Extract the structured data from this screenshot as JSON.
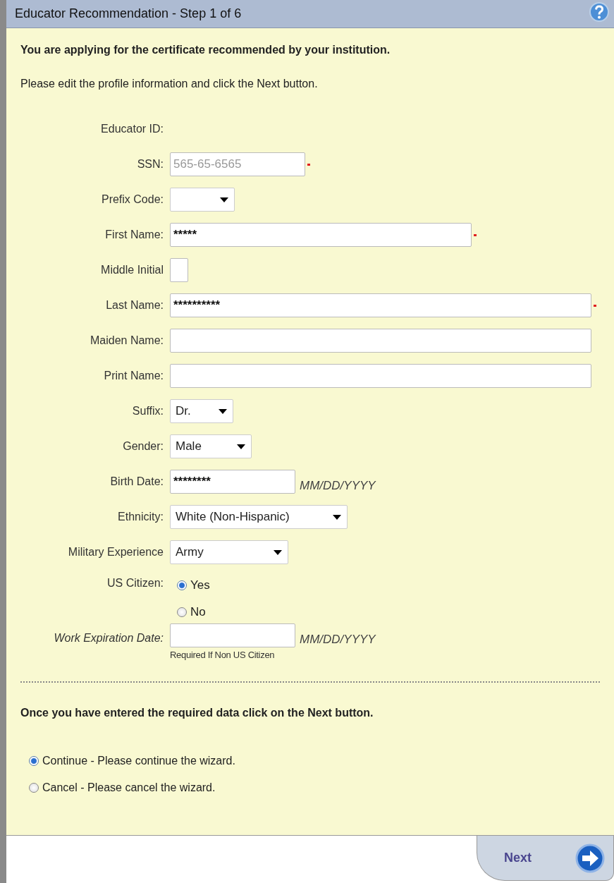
{
  "window": {
    "title": "Educator Recommendation - Step 1 of 6"
  },
  "intro": [
    "You are applying for the certificate recommended by your institution.",
    "Please edit the profile information and click the Next button."
  ],
  "fields": [
    {
      "kind": "label",
      "label": "Educator ID:"
    },
    {
      "kind": "text",
      "label": "SSN:",
      "placeholder": "565-65-6565",
      "required": true
    },
    {
      "kind": "select",
      "label": "Prefix Code:"
    },
    {
      "kind": "text",
      "label": "First Name:",
      "value": "*****",
      "required": true
    },
    {
      "kind": "text",
      "label": "Middle Initial",
      "required": false
    },
    {
      "kind": "text",
      "label": "Last Name:",
      "value": "**********",
      "required": true
    },
    {
      "kind": "text",
      "label": "Maiden Name:",
      "required": false
    },
    {
      "kind": "text",
      "label": "Print Name:",
      "required": false
    },
    {
      "kind": "select",
      "label": "Suffix:",
      "value": "Dr."
    },
    {
      "kind": "select",
      "label": "Gender:",
      "value": "Male"
    },
    {
      "kind": "text",
      "label": "Birth Date:",
      "value": "********",
      "format": "MM/DD/YYYY",
      "required": false
    },
    {
      "kind": "select",
      "label": "Ethnicity:",
      "value": "White (Non-Hispanic)"
    },
    {
      "kind": "select",
      "label": "Military Experience",
      "value": "Army"
    },
    {
      "kind": "radio",
      "label": "US Citizen:",
      "options": [
        {
          "label": "Yes",
          "selected": true
        },
        {
          "label": "No",
          "selected": false
        }
      ]
    },
    {
      "kind": "text",
      "label": "Work Expiration Date:",
      "italic": true,
      "format": "MM/DD/YYYY",
      "note": "Required If Non US Citizen",
      "required": false
    }
  ],
  "footer_note": "Once you have entered the required data click on the Next button.",
  "actions": [
    {
      "label": "Continue - Please continue the wizard.",
      "selected": true
    },
    {
      "label": "Cancel - Please cancel the wizard.",
      "selected": false
    }
  ],
  "next_button": {
    "label": "Next"
  }
}
